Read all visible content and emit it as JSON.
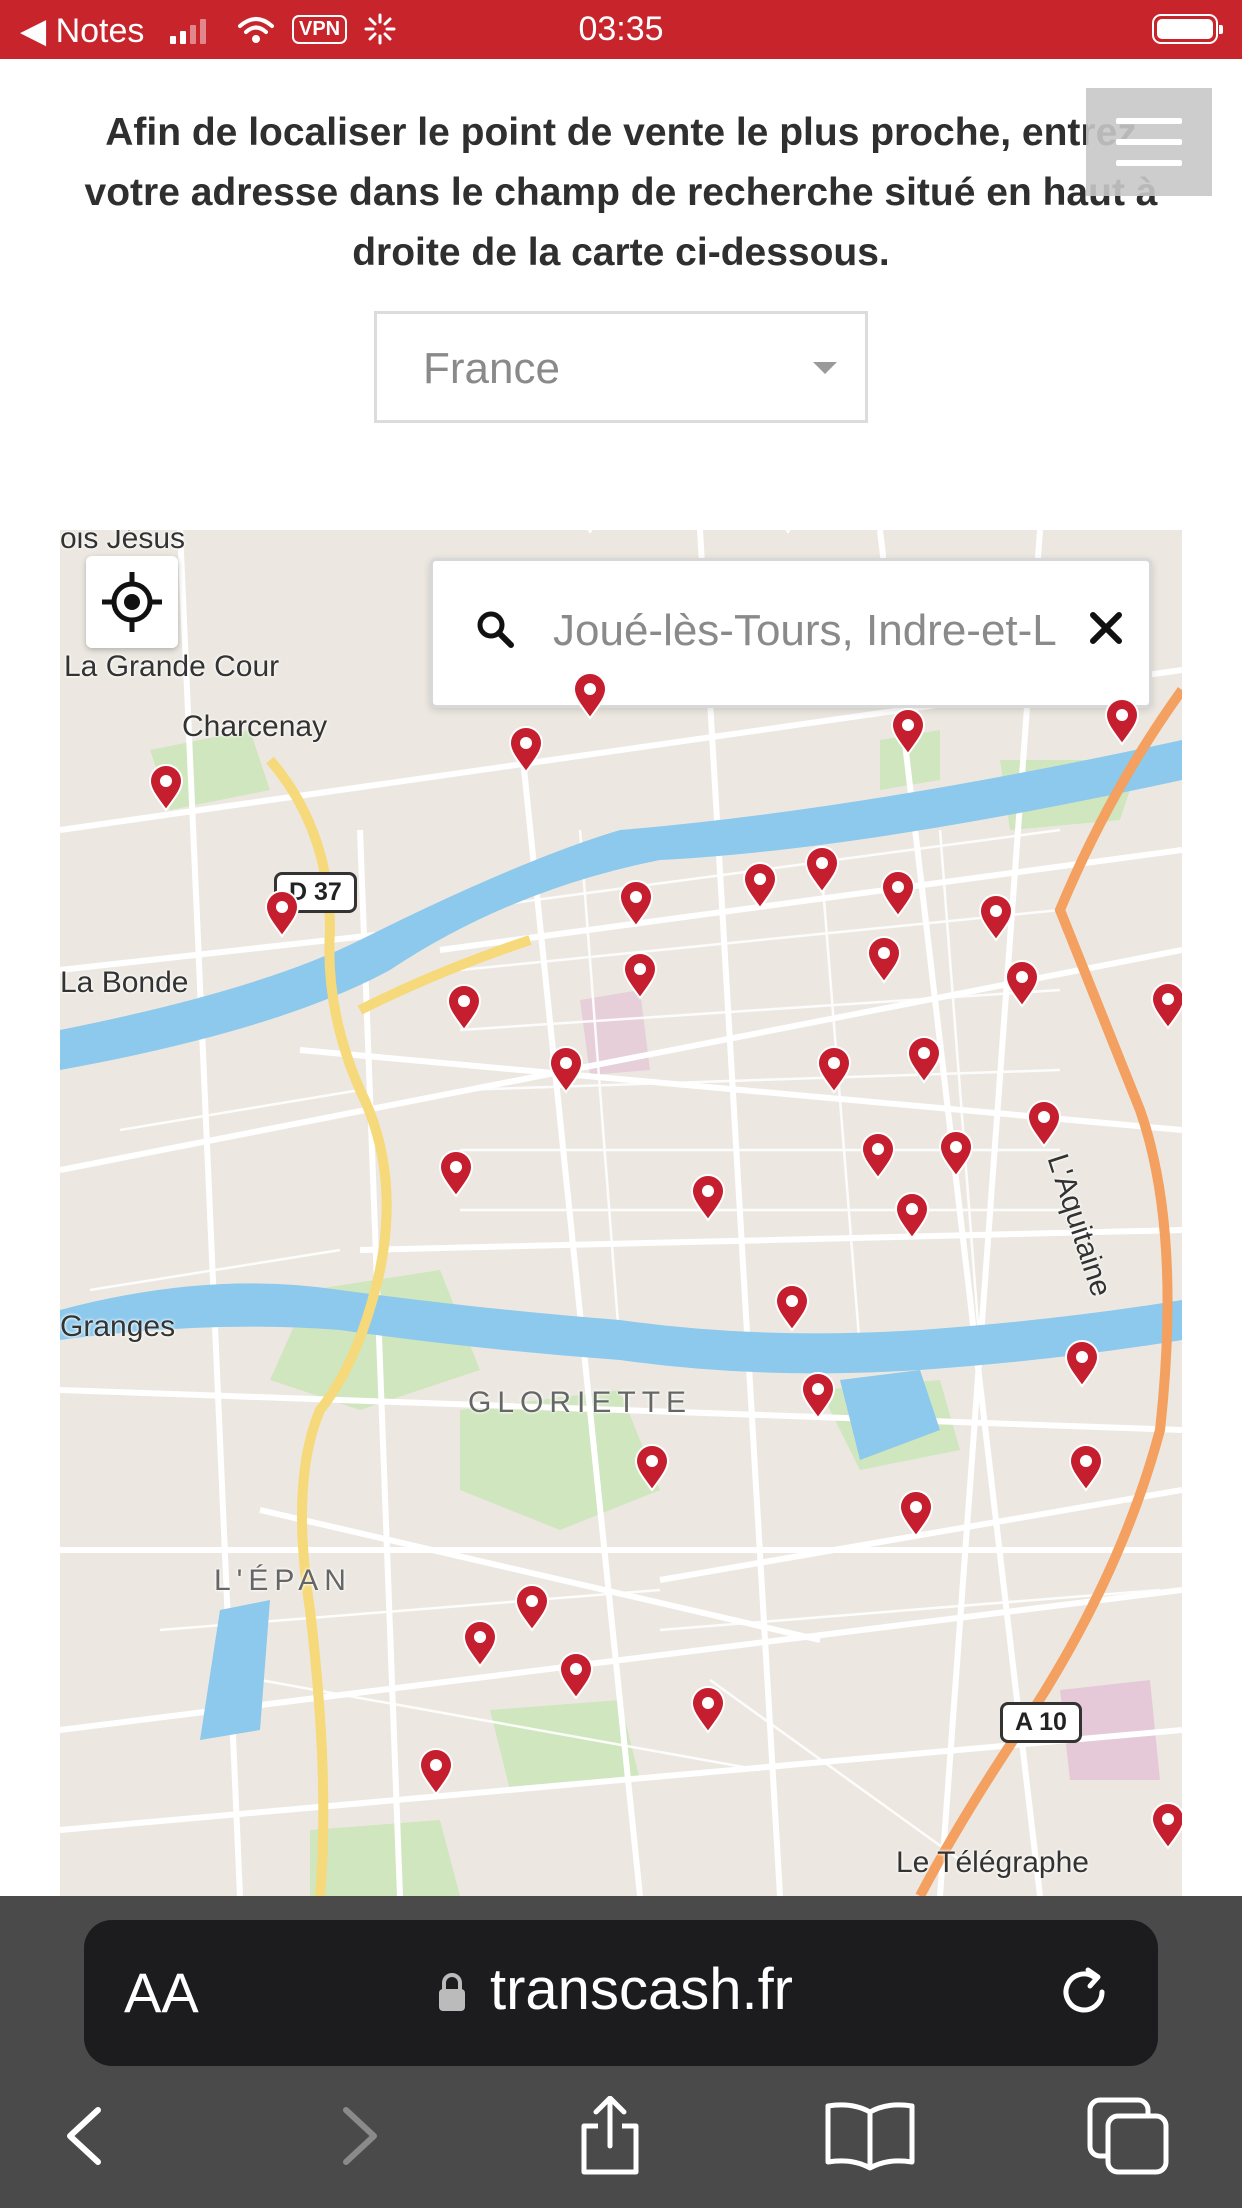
{
  "status_bar": {
    "back_label": "◀ Notes",
    "time": "03:35",
    "vpn_label": "VPN",
    "icons": [
      "signal-icon",
      "wifi-icon",
      "vpn-icon",
      "loading-spinner-icon",
      "battery-icon"
    ]
  },
  "page": {
    "instructions": "Afin de localiser le point de vente le plus proche, entrez votre adresse dans le champ de recherche situé en haut à droite de la carte ci-dessous.",
    "country_select": {
      "value": "France"
    },
    "menu_icon": "hamburger-menu-icon"
  },
  "map": {
    "search": {
      "value": "Joué-lès-Tours, Indre-et-L"
    },
    "labels": {
      "bois_jesus": "ois Jésus",
      "grande_cour": "La Grande Cour",
      "charcenay": "Charcenay",
      "la_bonde": "La Bonde",
      "granges": "Granges",
      "gloriette": "GLORIETTE",
      "lepan": "L'ÉPAN",
      "telegraphe": "Le Télégraphe",
      "aquitaine": "L'Aquitaine"
    },
    "road_shields": {
      "d37": "D 37",
      "a10": "A 10"
    },
    "pin_color": "#c41e2f",
    "river_color": "#8cc9ec",
    "icons": [
      "locate-me-icon",
      "search-icon",
      "close-icon",
      "map-pin-icon"
    ]
  },
  "browser": {
    "text_size_label": "AA",
    "domain": "transcash.fr",
    "icons": [
      "lock-icon",
      "reload-icon",
      "back-icon",
      "forward-icon",
      "share-icon",
      "bookmarks-icon",
      "tabs-icon"
    ]
  }
}
